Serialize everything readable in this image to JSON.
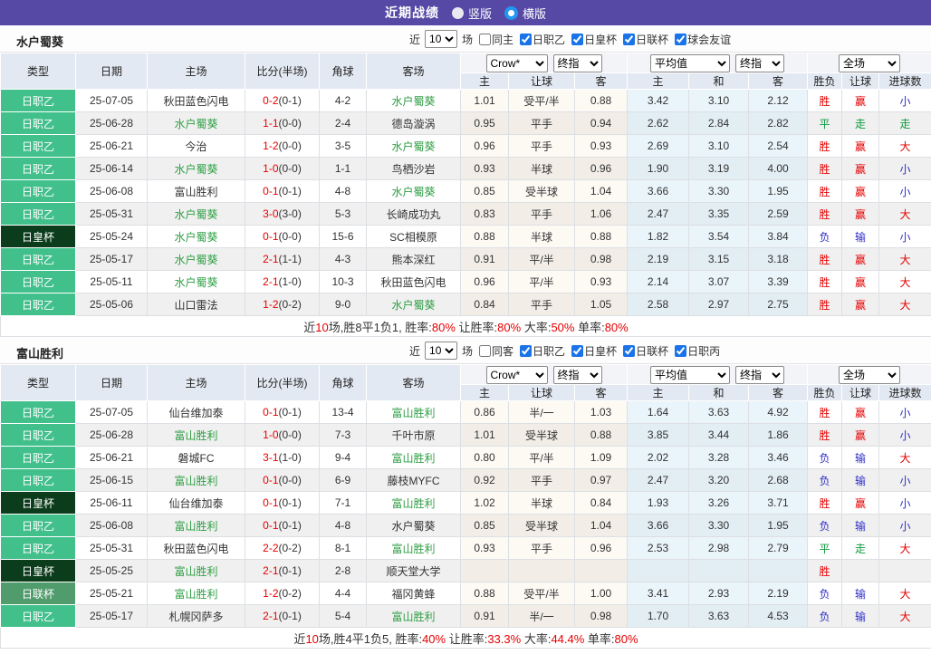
{
  "titlebar": {
    "title": "近期战绩",
    "radios": [
      {
        "label": "竖版",
        "selected": false
      },
      {
        "label": "横版",
        "selected": true
      }
    ]
  },
  "colors": {
    "topbar": "#5549A5",
    "league_jl2": "#41C08C",
    "league_emperor_cup": "#0B3C1B",
    "league_levain_cup": "#519C6C",
    "team_link_green": "#2E9E43",
    "score_red": "#E60000",
    "win_red": "#E60000",
    "lose_blue": "#2F2FC8",
    "draw_green": "#0B9A3E",
    "checkbox_accent": "#1A73E8"
  },
  "header": {
    "left_cols": [
      "类型",
      "日期",
      "主场",
      "比分(半场)",
      "角球",
      "客场"
    ],
    "groups": [
      {
        "selects": [
          {
            "value": "Crow*",
            "size": "m"
          },
          {
            "value": "终指",
            "size": "s"
          }
        ],
        "subcols": [
          "主",
          "让球",
          "客"
        ]
      },
      {
        "selects": [
          {
            "value": "平均值",
            "size": "l"
          },
          {
            "value": "终指",
            "size": "s"
          }
        ],
        "subcols": [
          "主",
          "和",
          "客"
        ]
      },
      {
        "selects": [
          {
            "value": "全场",
            "size": "m"
          }
        ],
        "subcols": [
          "胜负",
          "让球",
          "进球数"
        ]
      }
    ]
  },
  "filter_labels": {
    "near": "近",
    "matches": "场"
  },
  "sections": [
    {
      "team": "水户蜀葵",
      "filters": {
        "count": "10",
        "same": {
          "label": "同主",
          "checked": false
        },
        "leagues": [
          {
            "label": "日职乙",
            "checked": true
          },
          {
            "label": "日皇杯",
            "checked": true
          },
          {
            "label": "日联杯",
            "checked": true
          },
          {
            "label": "球会友谊",
            "checked": true
          }
        ]
      },
      "rows": [
        {
          "type": "日职乙",
          "badge": "l2",
          "date": "25-07-05",
          "home": "秋田蓝色闪电",
          "home_team": false,
          "ft": "0-2",
          "ht": "(0-1)",
          "corner": "4-2",
          "away": "水户蜀葵",
          "away_team": true,
          "odds": [
            "1.01",
            "受平/半",
            "0.88",
            "3.42",
            "3.10",
            "2.12"
          ],
          "res": [
            [
              "胜",
              "r"
            ],
            [
              "赢",
              "r"
            ],
            [
              "小",
              "b"
            ]
          ]
        },
        {
          "type": "日职乙",
          "badge": "l2",
          "date": "25-06-28",
          "home": "水户蜀葵",
          "home_team": true,
          "ft": "1-1",
          "ht": "(0-0)",
          "corner": "2-4",
          "away": "德岛漩涡",
          "away_team": false,
          "odds": [
            "0.95",
            "平手",
            "0.94",
            "2.62",
            "2.84",
            "2.82"
          ],
          "res": [
            [
              "平",
              "g"
            ],
            [
              "走",
              "g"
            ],
            [
              "走",
              "g"
            ]
          ]
        },
        {
          "type": "日职乙",
          "badge": "l2",
          "date": "25-06-21",
          "home": "今治",
          "home_team": false,
          "ft": "1-2",
          "ht": "(0-0)",
          "corner": "3-5",
          "away": "水户蜀葵",
          "away_team": true,
          "odds": [
            "0.96",
            "平手",
            "0.93",
            "2.69",
            "3.10",
            "2.54"
          ],
          "res": [
            [
              "胜",
              "r"
            ],
            [
              "赢",
              "r"
            ],
            [
              "大",
              "r"
            ]
          ]
        },
        {
          "type": "日职乙",
          "badge": "l2",
          "date": "25-06-14",
          "home": "水户蜀葵",
          "home_team": true,
          "ft": "1-0",
          "ht": "(0-0)",
          "corner": "1-1",
          "away": "鸟栖沙岩",
          "away_team": false,
          "odds": [
            "0.93",
            "半球",
            "0.96",
            "1.90",
            "3.19",
            "4.00"
          ],
          "res": [
            [
              "胜",
              "r"
            ],
            [
              "赢",
              "r"
            ],
            [
              "小",
              "b"
            ]
          ]
        },
        {
          "type": "日职乙",
          "badge": "l2",
          "date": "25-06-08",
          "home": "富山胜利",
          "home_team": false,
          "ft": "0-1",
          "ht": "(0-1)",
          "corner": "4-8",
          "away": "水户蜀葵",
          "away_team": true,
          "odds": [
            "0.85",
            "受半球",
            "1.04",
            "3.66",
            "3.30",
            "1.95"
          ],
          "res": [
            [
              "胜",
              "r"
            ],
            [
              "赢",
              "r"
            ],
            [
              "小",
              "b"
            ]
          ]
        },
        {
          "type": "日职乙",
          "badge": "l2",
          "date": "25-05-31",
          "home": "水户蜀葵",
          "home_team": true,
          "ft": "3-0",
          "ht": "(3-0)",
          "corner": "5-3",
          "away": "长崎成功丸",
          "away_team": false,
          "odds": [
            "0.83",
            "平手",
            "1.06",
            "2.47",
            "3.35",
            "2.59"
          ],
          "res": [
            [
              "胜",
              "r"
            ],
            [
              "赢",
              "r"
            ],
            [
              "大",
              "r"
            ]
          ]
        },
        {
          "type": "日皇杯",
          "badge": "hb",
          "date": "25-05-24",
          "home": "水户蜀葵",
          "home_team": true,
          "ft": "0-1",
          "ht": "(0-0)",
          "corner": "15-6",
          "away": "SC相模原",
          "away_team": false,
          "odds": [
            "0.88",
            "半球",
            "0.88",
            "1.82",
            "3.54",
            "3.84"
          ],
          "res": [
            [
              "负",
              "b"
            ],
            [
              "输",
              "b"
            ],
            [
              "小",
              "b"
            ]
          ]
        },
        {
          "type": "日职乙",
          "badge": "l2",
          "date": "25-05-17",
          "home": "水户蜀葵",
          "home_team": true,
          "ft": "2-1",
          "ht": "(1-1)",
          "corner": "4-3",
          "away": "熊本深红",
          "away_team": false,
          "odds": [
            "0.91",
            "平/半",
            "0.98",
            "2.19",
            "3.15",
            "3.18"
          ],
          "res": [
            [
              "胜",
              "r"
            ],
            [
              "赢",
              "r"
            ],
            [
              "大",
              "r"
            ]
          ]
        },
        {
          "type": "日职乙",
          "badge": "l2",
          "date": "25-05-11",
          "home": "水户蜀葵",
          "home_team": true,
          "ft": "2-1",
          "ht": "(1-0)",
          "corner": "10-3",
          "away": "秋田蓝色闪电",
          "away_team": false,
          "odds": [
            "0.96",
            "平/半",
            "0.93",
            "2.14",
            "3.07",
            "3.39"
          ],
          "res": [
            [
              "胜",
              "r"
            ],
            [
              "赢",
              "r"
            ],
            [
              "大",
              "r"
            ]
          ]
        },
        {
          "type": "日职乙",
          "badge": "l2",
          "date": "25-05-06",
          "home": "山口雷法",
          "home_team": false,
          "ft": "1-2",
          "ht": "(0-2)",
          "corner": "9-0",
          "away": "水户蜀葵",
          "away_team": true,
          "odds": [
            "0.84",
            "平手",
            "1.05",
            "2.58",
            "2.97",
            "2.75"
          ],
          "res": [
            [
              "胜",
              "r"
            ],
            [
              "赢",
              "r"
            ],
            [
              "大",
              "r"
            ]
          ]
        }
      ],
      "summary": [
        {
          "t": "近",
          "r": 0
        },
        {
          "t": "10",
          "r": 1
        },
        {
          "t": "场,胜8平1负1, 胜率:",
          "r": 0
        },
        {
          "t": "80%",
          "r": 1
        },
        {
          "t": " 让胜率:",
          "r": 0
        },
        {
          "t": "80%",
          "r": 1
        },
        {
          "t": " 大率:",
          "r": 0
        },
        {
          "t": "50%",
          "r": 1
        },
        {
          "t": " 单率:",
          "r": 0
        },
        {
          "t": "80%",
          "r": 1
        }
      ]
    },
    {
      "team": "富山胜利",
      "filters": {
        "count": "10",
        "same": {
          "label": "同客",
          "checked": false
        },
        "leagues": [
          {
            "label": "日职乙",
            "checked": true
          },
          {
            "label": "日皇杯",
            "checked": true
          },
          {
            "label": "日联杯",
            "checked": true
          },
          {
            "label": "日职丙",
            "checked": true
          }
        ]
      },
      "rows": [
        {
          "type": "日职乙",
          "badge": "l2",
          "date": "25-07-05",
          "home": "仙台维加泰",
          "home_team": false,
          "ft": "0-1",
          "ht": "(0-1)",
          "corner": "13-4",
          "away": "富山胜利",
          "away_team": true,
          "odds": [
            "0.86",
            "半/一",
            "1.03",
            "1.64",
            "3.63",
            "4.92"
          ],
          "res": [
            [
              "胜",
              "r"
            ],
            [
              "赢",
              "r"
            ],
            [
              "小",
              "b"
            ]
          ]
        },
        {
          "type": "日职乙",
          "badge": "l2",
          "date": "25-06-28",
          "home": "富山胜利",
          "home_team": true,
          "ft": "1-0",
          "ht": "(0-0)",
          "corner": "7-3",
          "away": "千叶市原",
          "away_team": false,
          "odds": [
            "1.01",
            "受半球",
            "0.88",
            "3.85",
            "3.44",
            "1.86"
          ],
          "res": [
            [
              "胜",
              "r"
            ],
            [
              "赢",
              "r"
            ],
            [
              "小",
              "b"
            ]
          ]
        },
        {
          "type": "日职乙",
          "badge": "l2",
          "date": "25-06-21",
          "home": "磐城FC",
          "home_team": false,
          "ft": "3-1",
          "ht": "(1-0)",
          "corner": "9-4",
          "away": "富山胜利",
          "away_team": true,
          "odds": [
            "0.80",
            "平/半",
            "1.09",
            "2.02",
            "3.28",
            "3.46"
          ],
          "res": [
            [
              "负",
              "b"
            ],
            [
              "输",
              "b"
            ],
            [
              "大",
              "r"
            ]
          ]
        },
        {
          "type": "日职乙",
          "badge": "l2",
          "date": "25-06-15",
          "home": "富山胜利",
          "home_team": true,
          "ft": "0-1",
          "ht": "(0-0)",
          "corner": "6-9",
          "away": "藤枝MYFC",
          "away_team": false,
          "odds": [
            "0.92",
            "平手",
            "0.97",
            "2.47",
            "3.20",
            "2.68"
          ],
          "res": [
            [
              "负",
              "b"
            ],
            [
              "输",
              "b"
            ],
            [
              "小",
              "b"
            ]
          ]
        },
        {
          "type": "日皇杯",
          "badge": "hb",
          "date": "25-06-11",
          "home": "仙台维加泰",
          "home_team": false,
          "ft": "0-1",
          "ht": "(0-1)",
          "corner": "7-1",
          "away": "富山胜利",
          "away_team": true,
          "odds": [
            "1.02",
            "半球",
            "0.84",
            "1.93",
            "3.26",
            "3.71"
          ],
          "res": [
            [
              "胜",
              "r"
            ],
            [
              "赢",
              "r"
            ],
            [
              "小",
              "b"
            ]
          ]
        },
        {
          "type": "日职乙",
          "badge": "l2",
          "date": "25-06-08",
          "home": "富山胜利",
          "home_team": true,
          "ft": "0-1",
          "ht": "(0-1)",
          "corner": "4-8",
          "away": "水户蜀葵",
          "away_team": false,
          "odds": [
            "0.85",
            "受半球",
            "1.04",
            "3.66",
            "3.30",
            "1.95"
          ],
          "res": [
            [
              "负",
              "b"
            ],
            [
              "输",
              "b"
            ],
            [
              "小",
              "b"
            ]
          ]
        },
        {
          "type": "日职乙",
          "badge": "l2",
          "date": "25-05-31",
          "home": "秋田蓝色闪电",
          "home_team": false,
          "ft": "2-2",
          "ht": "(0-2)",
          "corner": "8-1",
          "away": "富山胜利",
          "away_team": true,
          "odds": [
            "0.93",
            "平手",
            "0.96",
            "2.53",
            "2.98",
            "2.79"
          ],
          "res": [
            [
              "平",
              "g"
            ],
            [
              "走",
              "g"
            ],
            [
              "大",
              "r"
            ]
          ]
        },
        {
          "type": "日皇杯",
          "badge": "hb",
          "date": "25-05-25",
          "home": "富山胜利",
          "home_team": true,
          "ft": "2-1",
          "ht": "(0-1)",
          "corner": "2-8",
          "away": "顺天堂大学",
          "away_team": false,
          "odds": [
            "",
            "",
            "",
            "",
            "",
            ""
          ],
          "res": [
            [
              "胜",
              "r"
            ],
            [
              "",
              ""
            ],
            [
              "",
              ""
            ]
          ]
        },
        {
          "type": "日联杯",
          "badge": "lb",
          "date": "25-05-21",
          "home": "富山胜利",
          "home_team": true,
          "ft": "1-2",
          "ht": "(0-2)",
          "corner": "4-4",
          "away": "福冈黄蜂",
          "away_team": false,
          "odds": [
            "0.88",
            "受平/半",
            "1.00",
            "3.41",
            "2.93",
            "2.19"
          ],
          "res": [
            [
              "负",
              "b"
            ],
            [
              "输",
              "b"
            ],
            [
              "大",
              "r"
            ]
          ]
        },
        {
          "type": "日职乙",
          "badge": "l2",
          "date": "25-05-17",
          "home": "札幌冈萨多",
          "home_team": false,
          "ft": "2-1",
          "ht": "(0-1)",
          "corner": "5-4",
          "away": "富山胜利",
          "away_team": true,
          "odds": [
            "0.91",
            "半/一",
            "0.98",
            "1.70",
            "3.63",
            "4.53"
          ],
          "res": [
            [
              "负",
              "b"
            ],
            [
              "输",
              "b"
            ],
            [
              "大",
              "r"
            ]
          ]
        }
      ],
      "summary": [
        {
          "t": "近",
          "r": 0
        },
        {
          "t": "10",
          "r": 1
        },
        {
          "t": "场,胜4平1负5, 胜率:",
          "r": 0
        },
        {
          "t": "40%",
          "r": 1
        },
        {
          "t": " 让胜率:",
          "r": 0
        },
        {
          "t": "33.3%",
          "r": 1
        },
        {
          "t": " 大率:",
          "r": 0
        },
        {
          "t": "44.4%",
          "r": 1
        },
        {
          "t": " 单率:",
          "r": 0
        },
        {
          "t": "80%",
          "r": 1
        }
      ]
    }
  ]
}
